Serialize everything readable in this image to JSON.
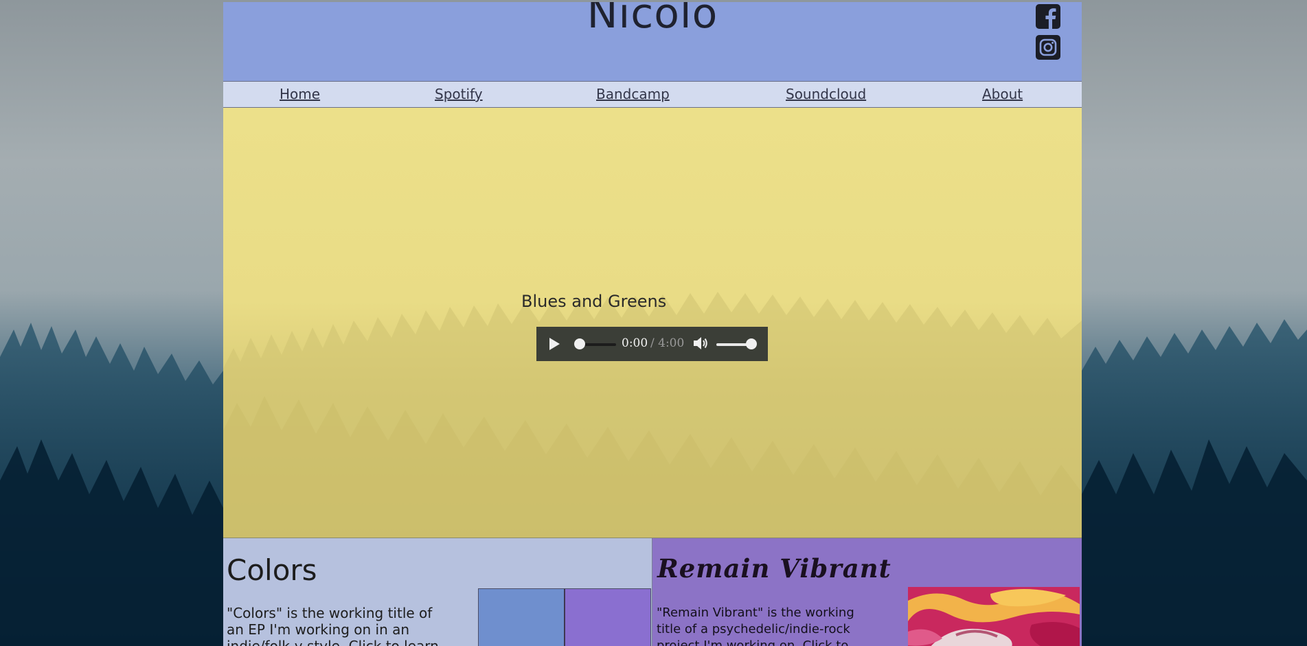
{
  "site": {
    "title": "Nicolo"
  },
  "social": [
    {
      "name": "facebook-icon"
    },
    {
      "name": "instagram-icon"
    }
  ],
  "nav": {
    "items": [
      {
        "label": "Home"
      },
      {
        "label": "Spotify"
      },
      {
        "label": "Bandcamp"
      },
      {
        "label": "Soundcloud"
      },
      {
        "label": "About"
      }
    ]
  },
  "hero": {
    "track_title": "Blues and Greens",
    "player": {
      "current_time": "0:00",
      "duration": "/ 4:00",
      "progress": 0,
      "volume": 1
    }
  },
  "projects": [
    {
      "title": "Colors",
      "description": "\"Colors\" is the working title of an EP I'm working on in an indie/folk-y style. Click to learn"
    },
    {
      "title": "Remain Vibrant",
      "description": "\"Remain Vibrant\" is the working title of a psychedelic/indie-rock project I'm working on. Click to"
    }
  ],
  "colors": {
    "header_bg": "#8a9fdc",
    "nav_bg": "#d3dbef",
    "hero_bg": "#ece08a",
    "card_left_bg": "#b6c1de",
    "card_right_bg": "#8c73c6"
  }
}
